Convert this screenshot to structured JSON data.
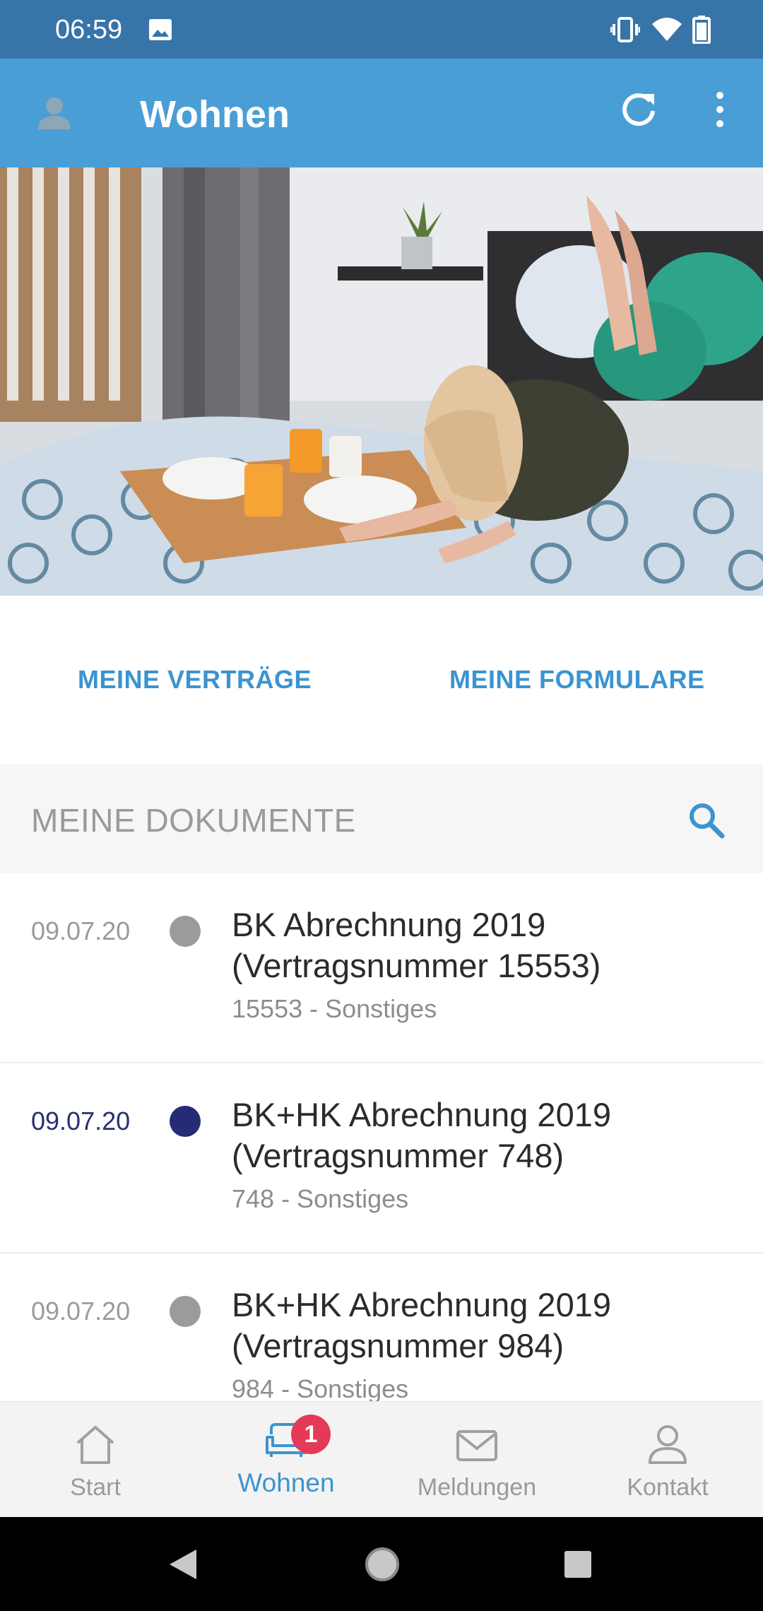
{
  "status_bar": {
    "time": "06:59",
    "icons": [
      "gallery-icon",
      "vibrate-icon",
      "wifi-icon",
      "battery-icon"
    ]
  },
  "app_bar": {
    "title": "Wohnen",
    "icons": [
      "avatar-icon",
      "refresh-icon",
      "more-vertical-icon"
    ]
  },
  "links": {
    "vertraege": "MEINE VERTRÄGE",
    "formulare": "MEINE FORMULARE"
  },
  "documents_section": {
    "title": "MEINE DOKUMENTE",
    "search_icon": "search-icon"
  },
  "documents": [
    {
      "date": "09.07.20",
      "title": "BK Abrechnung 2019 (Vertragsnummer 15553)",
      "subtitle": "15553 - Sonstiges",
      "unread": false
    },
    {
      "date": "09.07.20",
      "title": "BK+HK Abrechnung 2019 (Vertragsnummer 748)",
      "subtitle": "748 - Sonstiges",
      "unread": true
    },
    {
      "date": "09.07.20",
      "title": "BK+HK Abrechnung 2019 (Vertragsnummer 984)",
      "subtitle": "984 - Sonstiges",
      "unread": false
    }
  ],
  "bottom_nav": {
    "items": [
      {
        "label": "Start",
        "icon": "home-icon",
        "active": false
      },
      {
        "label": "Wohnen",
        "icon": "sofa-icon",
        "active": true,
        "badge": "1"
      },
      {
        "label": "Meldungen",
        "icon": "mail-icon",
        "active": false
      },
      {
        "label": "Kontakt",
        "icon": "person-icon",
        "active": false
      }
    ]
  },
  "colors": {
    "status_bar": "#3774a8",
    "app_bar": "#4a9ed6",
    "accent": "#3b94cf",
    "unread_dot": "#262b77",
    "read_dot": "#9b9b9b",
    "badge": "#e53a57"
  }
}
